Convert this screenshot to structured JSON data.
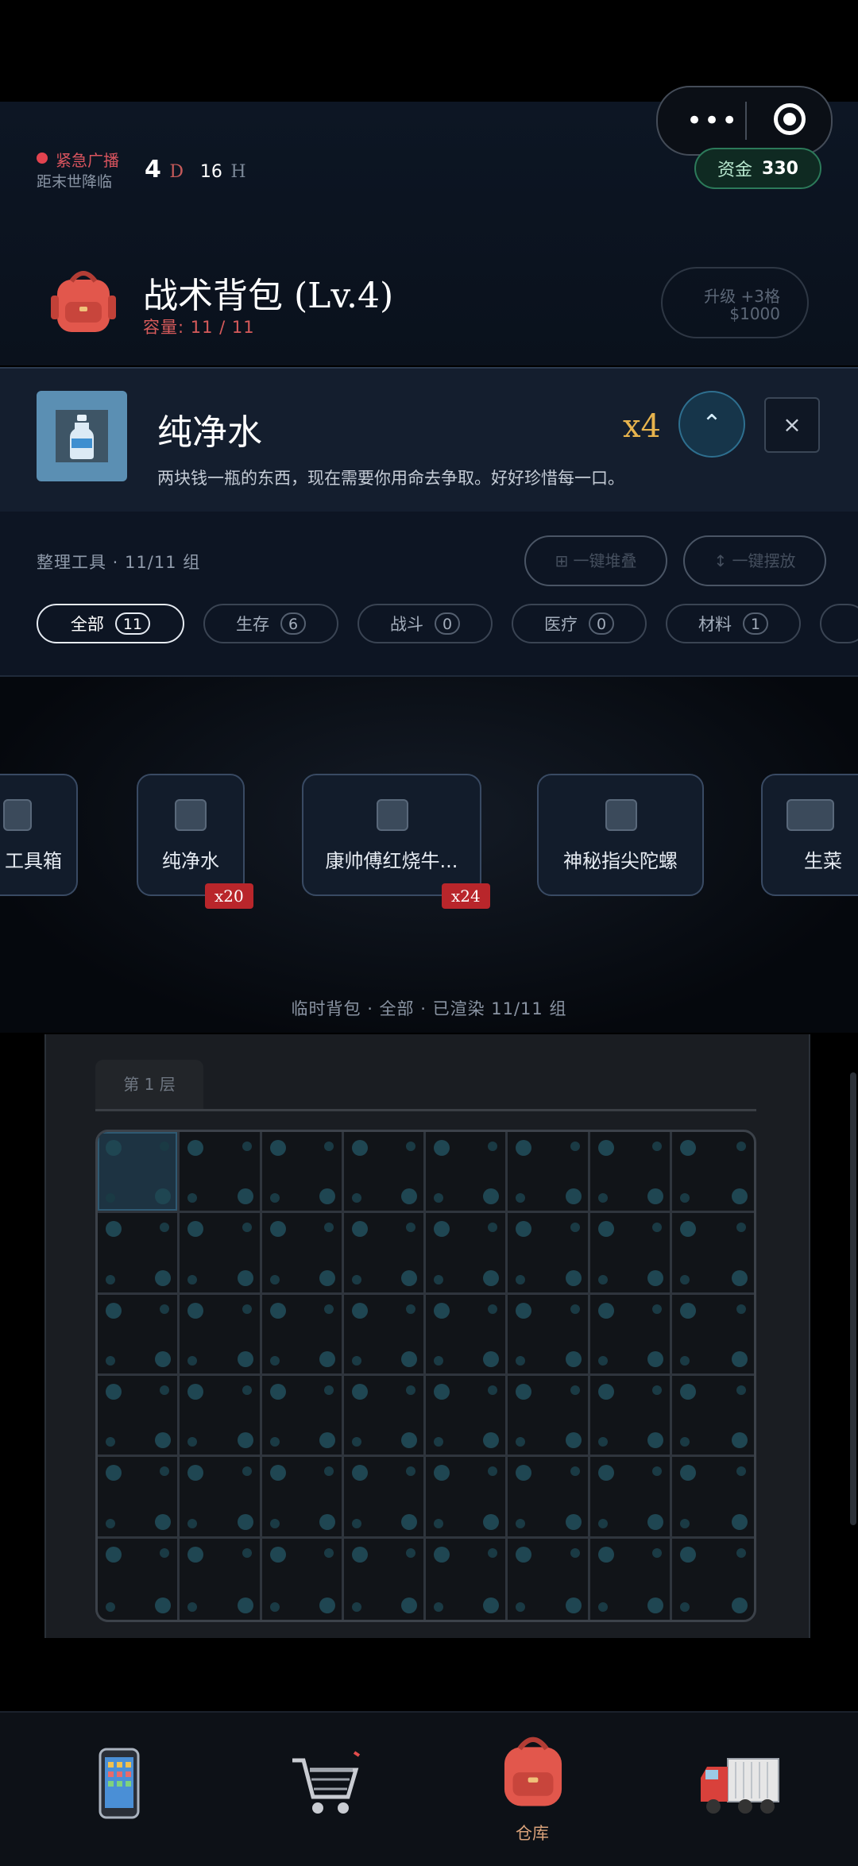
{
  "header": {
    "alert_label": "紧急广播",
    "alert_sub": "距末世降临",
    "days": "4",
    "days_unit": "D",
    "hours": "16",
    "hours_unit": "H",
    "fund_label": "资金",
    "fund_value": "330",
    "capsule_menu": "•••"
  },
  "bag": {
    "title": "战术背包 (Lv.4)",
    "capacity": "容量: 11 / 11",
    "upgrade_line1": "升级 +3格",
    "upgrade_line2": "$1000"
  },
  "detail": {
    "name": "纯净水",
    "desc": "两块钱一瓶的东西，现在需要你用命去争取。好好珍惜每一口。",
    "qty": "x4",
    "up_symbol": "⌃",
    "close_symbol": "×"
  },
  "tools": {
    "label": "整理工具 · 11/11 组",
    "stack_btn": "⊞ 一键堆叠",
    "arrange_btn": "↕ 一键摆放",
    "chips": [
      {
        "label": "全部",
        "count": "11"
      },
      {
        "label": "生存",
        "count": "6"
      },
      {
        "label": "战斗",
        "count": "0"
      },
      {
        "label": "医疗",
        "count": "0"
      },
      {
        "label": "材料",
        "count": "1"
      }
    ]
  },
  "shelf": {
    "items": [
      {
        "name": "工具箱"
      },
      {
        "name": "纯净水",
        "badge": "x20"
      },
      {
        "name": "康帅傅红烧牛...",
        "badge": "x24"
      },
      {
        "name": "神秘指尖陀螺"
      },
      {
        "name": "生菜"
      }
    ],
    "footer": "临时背包 · 全部 · 已渲染 11/11 组"
  },
  "grid": {
    "layer": "第 1 层",
    "rows": 6,
    "cols": 8
  },
  "nav": {
    "items": [
      {
        "icon": "phone-icon"
      },
      {
        "icon": "cart-icon"
      },
      {
        "icon": "backpack-icon",
        "label": "仓库"
      },
      {
        "icon": "truck-icon"
      }
    ]
  },
  "colors": {
    "accent_red": "#d75b5b",
    "qty_gold": "#e7b34d",
    "fund_green": "#2c7a5a",
    "badge_red": "#b9262b"
  }
}
